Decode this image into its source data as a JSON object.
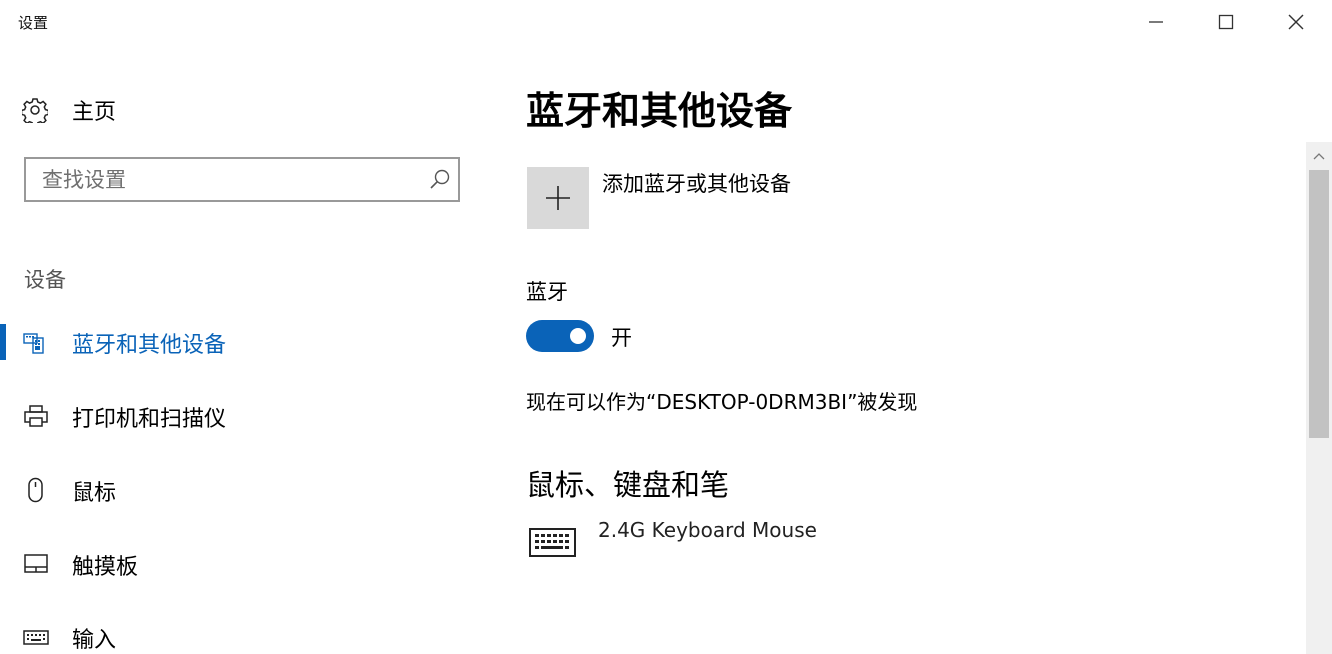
{
  "window": {
    "title": "设置"
  },
  "nav": {
    "home_label": "主页",
    "search_placeholder": "查找设置",
    "section_label": "设备",
    "items": [
      {
        "label": "蓝牙和其他设备",
        "icon": "bluetooth-devices-icon",
        "active": true
      },
      {
        "label": "打印机和扫描仪",
        "icon": "printer-icon",
        "active": false
      },
      {
        "label": "鼠标",
        "icon": "mouse-icon",
        "active": false
      },
      {
        "label": "触摸板",
        "icon": "touchpad-icon",
        "active": false
      },
      {
        "label": "输入",
        "icon": "keyboard-icon",
        "active": false
      }
    ]
  },
  "main": {
    "title": "蓝牙和其他设备",
    "add_device_label": "添加蓝牙或其他设备",
    "bluetooth_label": "蓝牙",
    "bluetooth_state": "开",
    "bluetooth_on": true,
    "discoverable_text": "现在可以作为“DESKTOP-0DRM3BI”被发现",
    "mouse_section_title": "鼠标、键盘和笔",
    "devices": [
      {
        "name": "2.4G Keyboard Mouse",
        "icon": "keyboard-icon"
      }
    ]
  },
  "colors": {
    "accent": "#0a63b8",
    "tile_bg": "#d9d9d9",
    "scroll_thumb": "#c2c2c2"
  }
}
